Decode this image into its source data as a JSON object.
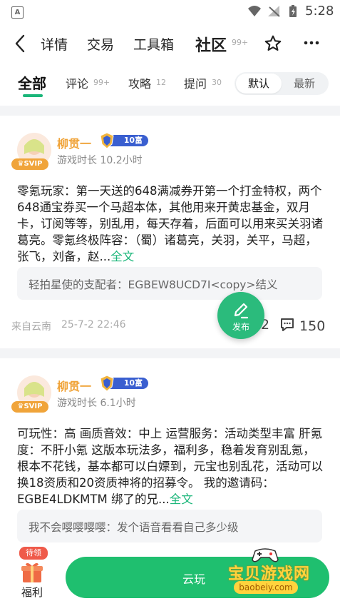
{
  "status_bar": {
    "time": "5:28",
    "app_letter": "A"
  },
  "nav": {
    "items": [
      {
        "label": "详情"
      },
      {
        "label": "交易"
      },
      {
        "label": "工具箱"
      },
      {
        "label": "社区",
        "count": "99+"
      }
    ]
  },
  "filters": {
    "tabs": [
      {
        "label": "全部"
      },
      {
        "label": "评论",
        "count": "99+"
      },
      {
        "label": "攻略",
        "count": "12"
      },
      {
        "label": "提问",
        "count": "30"
      }
    ],
    "sort": {
      "selected": "默认",
      "other": "最新"
    }
  },
  "posts": [
    {
      "username": "柳贯一",
      "rank": "10富",
      "badge": "SVIP",
      "playtime": "游戏时长 10.2小时",
      "content": "零氪玩家：第一天送的648满减券开第一个打金特权，两个648通宝券买一个马超本体，其他用来开黄忠基金，双月卡，订阅等等，别乱用，每天存着，后面可以用来买关羽诸葛亮。零氪终极阵容：（蜀）诸葛亮，关羽，关平，马超，张飞，刘备，赵...",
      "fulltext_label": "全文",
      "reply": "轻拍星使的支配者：EGBEW8UCD7I<copy>结义",
      "source": "来自云南",
      "date": "25-7-2 22:46",
      "likes": "2",
      "comments": "150"
    },
    {
      "username": "柳贯一",
      "rank": "10富",
      "badge": "SVIP",
      "playtime": "游戏时长 6.1小时",
      "content": "可玩性：高 画质音效：中上 运营服务：活动类型丰富 肝氪度：不肝小氪 这版本玩法多，福利多，稳着发育别乱氪，根本不花钱，基本都可以白嫖到，元宝也别乱花，活动可以换18资质和20资质神将的招募令。 我的邀请码：EGBE4LDKMTM 绑了的兄...",
      "fulltext_label": "全文",
      "reply": "我不会嘤嘤嘤嘤：发个语音看看自己多少级"
    }
  ],
  "fab": {
    "label": "发布"
  },
  "bottom": {
    "badge": "待领",
    "welfare_label": "福利",
    "cloud_label": "云玩",
    "watermark_title": "宝贝游戏网",
    "watermark_url": "baobeiy.com"
  },
  "colors": {
    "accent": "#1bb67a",
    "gold": "#f0a43a",
    "rank_blue": "#3a5fd0",
    "badge_red": "#ef5a4a"
  }
}
